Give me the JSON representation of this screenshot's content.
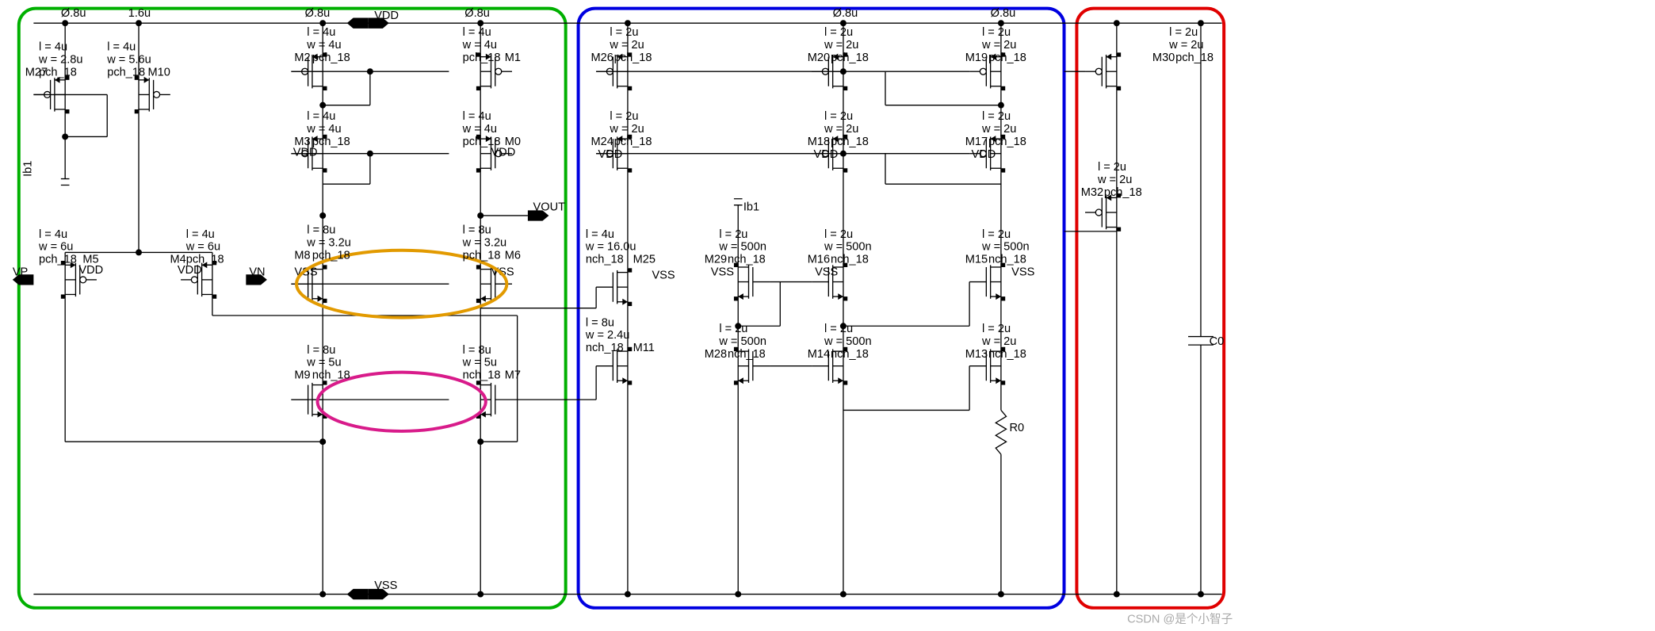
{
  "supplies": {
    "vdd": "VDD",
    "vss": "VSS",
    "vout": "VOUT",
    "vp": "VP",
    "vn": "VN",
    "ib1": "Ib1"
  },
  "dims": {
    "w08": "Ø.8u",
    "w16": "1.6u"
  },
  "components": {
    "R0": "R0",
    "C0": "C0"
  },
  "tx": {
    "M27": {
      "id": "M27",
      "l": "l = 4u",
      "w": "w = 2.8u",
      "t": "pch_18"
    },
    "M10": {
      "id": "M10",
      "l": "l = 4u",
      "w": "w = 5.6u",
      "t": "pch_18"
    },
    "M5": {
      "id": "M5",
      "l": "l = 4u",
      "w": "w = 6u",
      "t": "pch_18"
    },
    "M4": {
      "id": "M4",
      "l": "l = 4u",
      "w": "w = 6u",
      "t": "pch_18"
    },
    "M2": {
      "id": "M2",
      "l": "l = 4u",
      "w": "w = 4u",
      "t": "pch_18"
    },
    "M1": {
      "id": "M1",
      "l": "l = 4u",
      "w": "w = 4u",
      "t": "pch_18"
    },
    "M3": {
      "id": "M3",
      "l": "l = 4u",
      "w": "w = 4u",
      "t": "pch_18"
    },
    "M0": {
      "id": "M0",
      "l": "l = 4u",
      "w": "w = 4u",
      "t": "pch_18"
    },
    "M8": {
      "id": "M8",
      "l": "l = 8u",
      "w": "w = 3.2u",
      "t": "pch_18"
    },
    "M6": {
      "id": "M6",
      "l": "l = 8u",
      "w": "w = 3.2u",
      "t": "pch_18"
    },
    "M9": {
      "id": "M9",
      "l": "l = 8u",
      "w": "w = 5u",
      "t": "nch_18"
    },
    "M7": {
      "id": "M7",
      "l": "l = 8u",
      "w": "w = 5u",
      "t": "nch_18"
    },
    "M26": {
      "id": "M26",
      "l": "l = 2u",
      "w": "w = 2u",
      "t": "pch_18"
    },
    "M24": {
      "id": "M24",
      "l": "l = 2u",
      "w": "w = 2u",
      "t": "pch_18"
    },
    "M25": {
      "id": "M25",
      "l": "l = 4u",
      "w": "w = 16.0u",
      "t": "nch_18"
    },
    "M11": {
      "id": "M11",
      "l": "l = 8u",
      "w": "w = 2.4u",
      "t": "nch_18"
    },
    "M20": {
      "id": "M20",
      "l": "l = 2u",
      "w": "w = 2u",
      "t": "pch_18"
    },
    "M18": {
      "id": "M18",
      "l": "l = 2u",
      "w": "w = 2u",
      "t": "pch_18"
    },
    "M29": {
      "id": "M29",
      "l": "l = 2u",
      "w": "w = 500n",
      "t": "nch_18"
    },
    "M16": {
      "id": "M16",
      "l": "l = 2u",
      "w": "w = 500n",
      "t": "nch_18"
    },
    "M28": {
      "id": "M28",
      "l": "l = 2u",
      "w": "w = 500n",
      "t": "nch_18"
    },
    "M14": {
      "id": "M14",
      "l": "l = 2u",
      "w": "w = 500n",
      "t": "nch_18"
    },
    "M19": {
      "id": "M19",
      "l": "l = 2u",
      "w": "w = 2u",
      "t": "pch_18"
    },
    "M17": {
      "id": "M17",
      "l": "l = 2u",
      "w": "w = 2u",
      "t": "pch_18"
    },
    "M15": {
      "id": "M15",
      "l": "l = 2u",
      "w": "w = 500n",
      "t": "nch_18"
    },
    "M13": {
      "id": "M13",
      "l": "l = 2u",
      "w": "w = 2u",
      "t": "nch_18"
    },
    "M30": {
      "id": "M30",
      "l": "l = 2u",
      "w": "w = 2u",
      "t": "pch_18"
    },
    "M32": {
      "id": "M32",
      "l": "l = 2u",
      "w": "w = 2u",
      "t": "pch_18"
    }
  },
  "watermark": "CSDN @是个小智子"
}
